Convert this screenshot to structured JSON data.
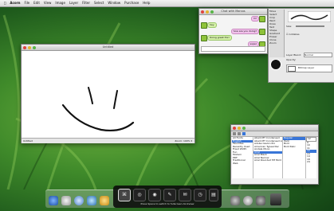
{
  "menubar": {
    "items": [
      "Acorn",
      "File",
      "Edit",
      "View",
      "Image",
      "Layer",
      "Filter",
      "Select",
      "Window",
      "Purchase",
      "Help"
    ]
  },
  "sketch_window": {
    "title": "Untitled",
    "status_left": "Untitled",
    "status_right": "Zoom: 100% ▾"
  },
  "chat_window": {
    "title": "Chat with Marcos",
    "messages": [
      {
        "side": "right",
        "text": "hi!"
      },
      {
        "side": "left",
        "text": "hey"
      },
      {
        "side": "right",
        "text": "how are you doing?"
      },
      {
        "side": "left",
        "text": "Doing great thx!"
      },
      {
        "side": "right",
        "text": "super"
      }
    ]
  },
  "tools_panel": {
    "items": [
      "Move",
      "Select",
      "Crop",
      "Paint",
      "Draw",
      "Text",
      "Shape",
      "Gradient",
      "Eraser",
      "Clone",
      "Zoom"
    ],
    "size_label": "Size:",
    "antialias_label": "Antialias",
    "layer_label": "Layer Blend:",
    "layer_value": "Normal",
    "opacity_label": "Opacity:",
    "bitmap_layer": "Bitmap Layer"
  },
  "font_panel": {
    "col1": [
      "All Fonts",
      "English",
      "Favorites",
      "Recently Used",
      "Fixed Width",
      "Fun",
      "Modern",
      "PDF",
      "Traditional",
      "Web"
    ],
    "col2": [
      "Abadi MT Condensed",
      "Abadi MT Condensed Light",
      "Adobe Caslon Pro",
      "American Typewriter",
      "Andale Mono",
      "Arial",
      "Arial Black",
      "Arial Narrow",
      "Arial Rounded MT Bold"
    ],
    "col3": [
      "Regular",
      "Italic",
      "Bold",
      "Bold Italic"
    ],
    "sizes": [
      "12",
      "9",
      "10",
      "11",
      "12",
      "13",
      "14",
      "18",
      "24"
    ]
  },
  "switcher": {
    "hint": "Press Space to switch to fullscreen dockview"
  },
  "colors": {
    "accent": "#3875d7",
    "chat_left": "#d4f0a8",
    "chat_right": "#f2c2ec"
  }
}
